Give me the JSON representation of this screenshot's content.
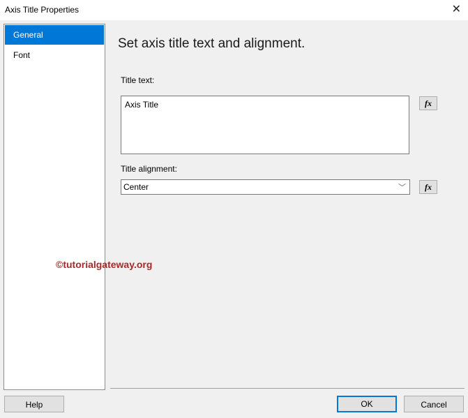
{
  "window": {
    "title": "Axis Title Properties",
    "close_icon": "close-icon"
  },
  "nav": {
    "items": [
      {
        "label": "General",
        "selected": true
      },
      {
        "label": "Font",
        "selected": false
      }
    ]
  },
  "main": {
    "heading": "Set axis title text and alignment.",
    "title_text_label": "Title text:",
    "title_text_value": "Axis Title",
    "alignment_label": "Title alignment:",
    "alignment_value": "Center",
    "fx_label": "fx"
  },
  "watermark": "©tutorialgateway.org",
  "buttons": {
    "help": "Help",
    "ok": "OK",
    "cancel": "Cancel"
  },
  "colors": {
    "accent": "#0078d7",
    "watermark": "#a52a2a"
  }
}
